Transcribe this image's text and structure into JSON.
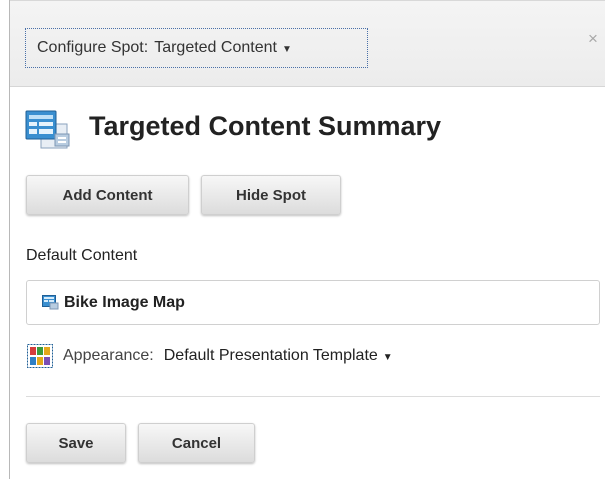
{
  "header": {
    "configure_label": "Configure Spot:",
    "configure_value": "Targeted Content",
    "close_symbol": "×"
  },
  "summary": {
    "title": "Targeted Content Summary",
    "icon": "targeted-content-summary-icon"
  },
  "actions": {
    "add_content": "Add Content",
    "hide_spot": "Hide Spot"
  },
  "default_content": {
    "label": "Default Content",
    "item": "Bike Image Map",
    "item_icon": "image-map-icon"
  },
  "appearance": {
    "label": "Appearance:",
    "value": "Default Presentation Template",
    "icon": "presentation-template-icon"
  },
  "footer": {
    "save": "Save",
    "cancel": "Cancel"
  },
  "colors": {
    "icon_blue": "#2f86c8",
    "dotted_border": "#4a70a8"
  }
}
